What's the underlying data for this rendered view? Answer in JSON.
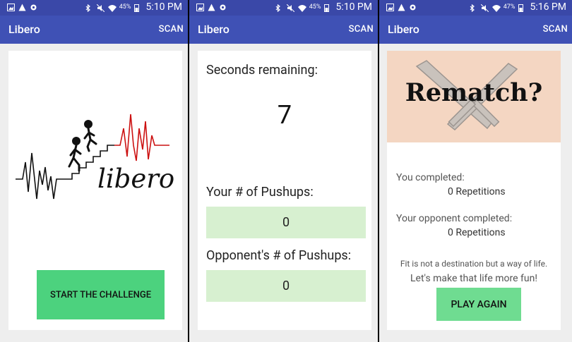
{
  "screens": [
    {
      "status": {
        "battery": "45%",
        "time": "5:10 PM"
      },
      "app": {
        "title": "Libero",
        "scan": "SCAN"
      },
      "logo": {
        "wordmark": "libero"
      },
      "start_button": "START THE CHALLENGE"
    },
    {
      "status": {
        "battery": "45%",
        "time": "5:10 PM"
      },
      "app": {
        "title": "Libero",
        "scan": "SCAN"
      },
      "timer": {
        "label": "Seconds remaining:",
        "value": "7"
      },
      "your_pushups": {
        "label": "Your # of Pushups:",
        "value": "0"
      },
      "opponent_pushups": {
        "label": "Opponent's # of Pushups:",
        "value": "0"
      }
    },
    {
      "status": {
        "battery": "47%",
        "time": "5:16 PM"
      },
      "app": {
        "title": "Libero",
        "scan": "SCAN"
      },
      "banner": "Rematch?",
      "you": {
        "label": "You completed:",
        "value": "0 Repetitions"
      },
      "opponent": {
        "label": "Your opponent completed:",
        "value": "0 Repetitions"
      },
      "tagline": {
        "line1": "Fit is not a destination but a way of life.",
        "line2": "Let's make that life more fun!"
      },
      "play_again": "PLAY AGAIN"
    }
  ],
  "colors": {
    "statusbar": "#3a48a8",
    "appbar": "#3f51b5",
    "start_button": "#4cd27e",
    "count_box": "#d7f0d0",
    "play_button": "#6fdc91",
    "rematch_bg": "#f4d6c2",
    "heartbeat_red": "#cc1111"
  },
  "icons": [
    "image-icon",
    "warning-icon",
    "settings-icon",
    "bluetooth-icon",
    "mute-icon",
    "wifi-icon",
    "signal-icon",
    "battery-icon",
    "stick-figure-icon",
    "crossed-swords-icon"
  ]
}
